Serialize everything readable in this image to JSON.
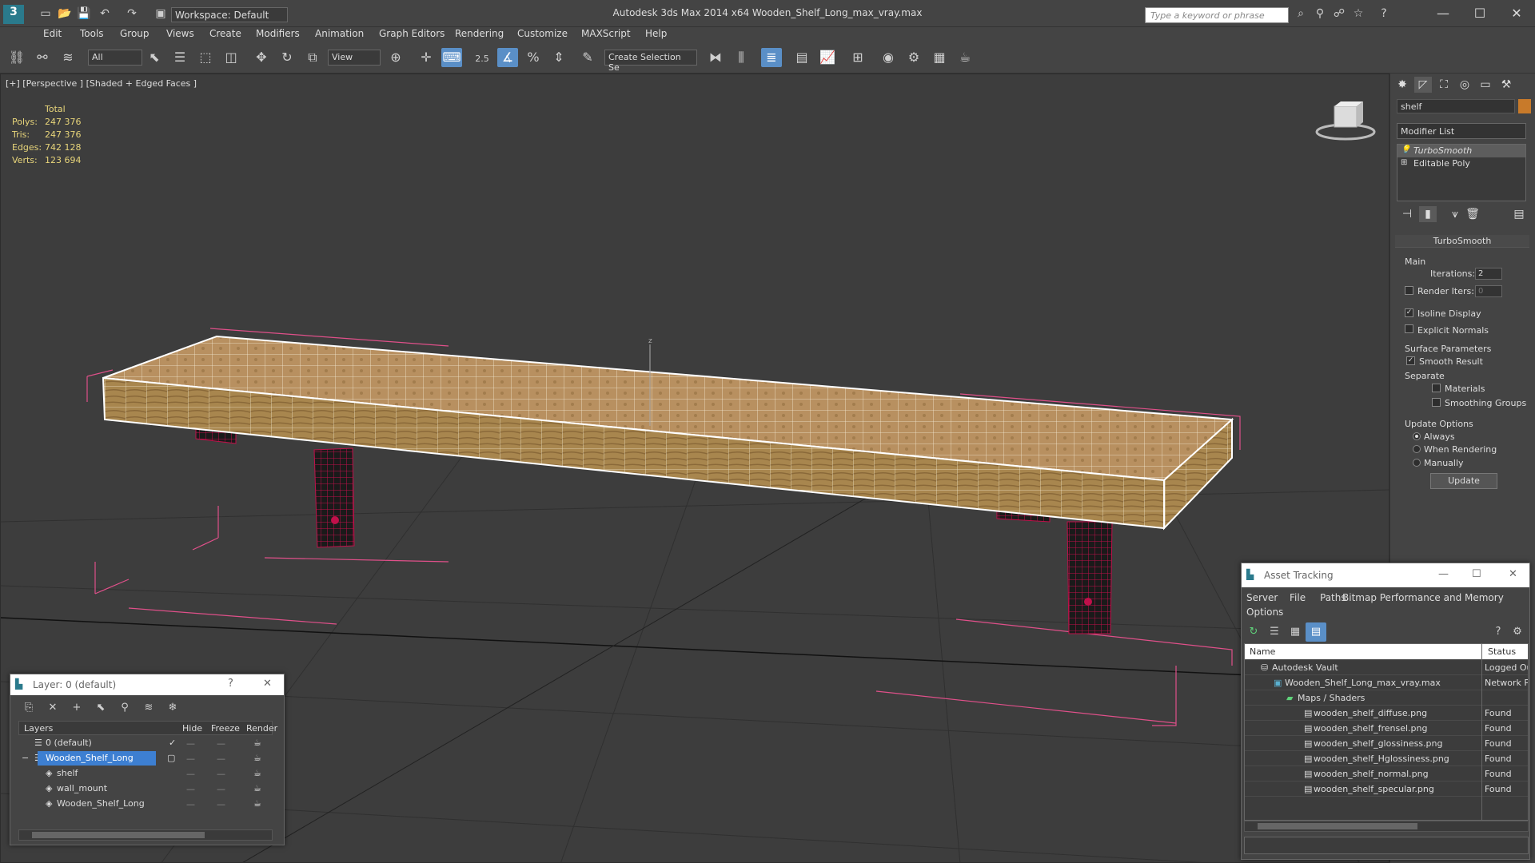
{
  "titlebar": {
    "title": "Autodesk 3ds Max  2014 x64      Wooden_Shelf_Long_max_vray.max",
    "workspace": "Workspace: Default",
    "search_placeholder": "Type a keyword or phrase"
  },
  "menu": [
    "Edit",
    "Tools",
    "Group",
    "Views",
    "Create",
    "Modifiers",
    "Animation",
    "Graph Editors",
    "Rendering",
    "Customize",
    "MAXScript",
    "Help"
  ],
  "toolbar": {
    "selection_filter": "All",
    "reference_coord": "View",
    "snap_value": "2.5",
    "named_selection": "Create Selection Se"
  },
  "viewport": {
    "label": "[+] [Perspective ] [Shaded + Edged Faces ]",
    "stats": {
      "header": "Total",
      "polys_label": "Polys:",
      "polys": "247 376",
      "tris_label": "Tris:",
      "tris": "247 376",
      "edges_label": "Edges:",
      "edges": "742 128",
      "verts_label": "Verts:",
      "verts": "123 694"
    }
  },
  "command_panel": {
    "object_name": "shelf",
    "modifier_list": "Modifier List",
    "stack": [
      "TurboSmooth",
      "Editable Poly"
    ],
    "turbosmooth": {
      "title": "TurboSmooth",
      "main": "Main",
      "iterations_label": "Iterations:",
      "iterations": "2",
      "render_iters_label": "Render Iters:",
      "render_iters": "0",
      "isoline": "Isoline Display",
      "explicit_normals": "Explicit Normals",
      "surface_params": "Surface Parameters",
      "smooth_result": "Smooth Result",
      "separate": "Separate",
      "materials": "Materials",
      "smoothing_groups": "Smoothing Groups",
      "update_options": "Update Options",
      "always": "Always",
      "when_rendering": "When Rendering",
      "manually": "Manually",
      "update_button": "Update"
    }
  },
  "layer_dialog": {
    "title": "Layer: 0 (default)",
    "help": "?",
    "columns": [
      "Layers",
      "Hide",
      "Freeze",
      "Render"
    ],
    "rows": [
      {
        "name": "0 (default)"
      },
      {
        "name": "Wooden_Shelf_Long"
      },
      {
        "name": "shelf"
      },
      {
        "name": "wall_mount"
      },
      {
        "name": "Wooden_Shelf_Long"
      }
    ]
  },
  "asset_tracking": {
    "title": "Asset Tracking",
    "menu": [
      "Server",
      "File",
      "Paths",
      "Bitmap Performance and Memory",
      "Options"
    ],
    "columns": [
      "Name",
      "Status"
    ],
    "rows": [
      {
        "name": "Autodesk Vault",
        "status": "Logged Ou"
      },
      {
        "name": "Wooden_Shelf_Long_max_vray.max",
        "status": "Network P"
      },
      {
        "name": "Maps / Shaders",
        "status": ""
      },
      {
        "name": "wooden_shelf_diffuse.png",
        "status": "Found"
      },
      {
        "name": "wooden_shelf_frensel.png",
        "status": "Found"
      },
      {
        "name": "wooden_shelf_glossiness.png",
        "status": "Found"
      },
      {
        "name": "wooden_shelf_Hglossiness.png",
        "status": "Found"
      },
      {
        "name": "wooden_shelf_normal.png",
        "status": "Found"
      },
      {
        "name": "wooden_shelf_specular.png",
        "status": "Found"
      }
    ]
  },
  "colors": {
    "accent": "#5a8fc7",
    "stats": "#e8d57a",
    "wireframe": "#c0104a",
    "bbox": "#e0508a"
  }
}
